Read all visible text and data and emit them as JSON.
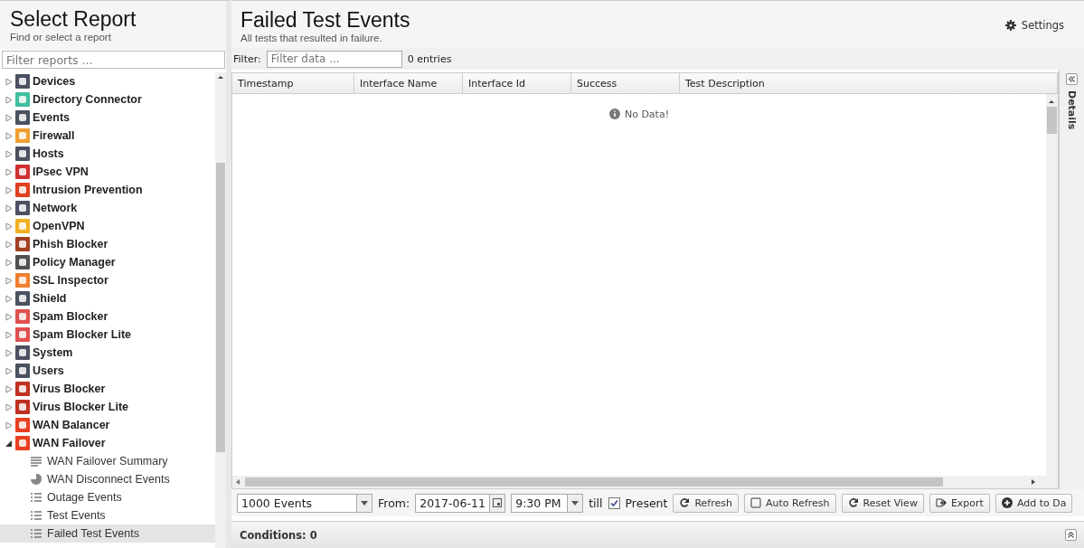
{
  "sidebar": {
    "title": "Select Report",
    "subtitle": "Find or select a report",
    "filter": {
      "placeholder": "Filter reports ..."
    },
    "items": [
      {
        "label": "Devices",
        "color": "#4a5160",
        "expanded": false
      },
      {
        "label": "Directory Connector",
        "color": "#3fbf9f",
        "expanded": false
      },
      {
        "label": "Events",
        "color": "#4a5160",
        "expanded": false
      },
      {
        "label": "Firewall",
        "color": "#f0a030",
        "expanded": false
      },
      {
        "label": "Hosts",
        "color": "#4a5160",
        "expanded": false
      },
      {
        "label": "IPsec VPN",
        "color": "#d03030",
        "expanded": false
      },
      {
        "label": "Intrusion Prevention",
        "color": "#e04020",
        "expanded": false
      },
      {
        "label": "Network",
        "color": "#4a5160",
        "expanded": false
      },
      {
        "label": "OpenVPN",
        "color": "#f0b020",
        "expanded": false
      },
      {
        "label": "Phish Blocker",
        "color": "#a04020",
        "expanded": false
      },
      {
        "label": "Policy Manager",
        "color": "#505050",
        "expanded": false
      },
      {
        "label": "SSL Inspector",
        "color": "#f08030",
        "expanded": false
      },
      {
        "label": "Shield",
        "color": "#4a5160",
        "expanded": false
      },
      {
        "label": "Spam Blocker",
        "color": "#e05050",
        "expanded": false
      },
      {
        "label": "Spam Blocker Lite",
        "color": "#e05050",
        "expanded": false
      },
      {
        "label": "System",
        "color": "#4a5160",
        "expanded": false
      },
      {
        "label": "Users",
        "color": "#4a5160",
        "expanded": false
      },
      {
        "label": "Virus Blocker",
        "color": "#c03020",
        "expanded": false
      },
      {
        "label": "Virus Blocker Lite",
        "color": "#c03020",
        "expanded": false
      },
      {
        "label": "WAN Balancer",
        "color": "#e84020",
        "expanded": false
      },
      {
        "label": "WAN Failover",
        "color": "#e84020",
        "expanded": true,
        "children": [
          {
            "label": "WAN Failover Summary",
            "kind": "summary",
            "selected": false
          },
          {
            "label": "WAN Disconnect Events",
            "kind": "pie",
            "selected": false
          },
          {
            "label": "Outage Events",
            "kind": "list",
            "selected": false
          },
          {
            "label": "Test Events",
            "kind": "list",
            "selected": false
          },
          {
            "label": "Failed Test Events",
            "kind": "list",
            "selected": true
          }
        ]
      }
    ]
  },
  "main": {
    "title": "Failed Test Events",
    "subtitle": "All tests that resulted in failure.",
    "settings": "Settings",
    "filter": {
      "label": "Filter:",
      "placeholder": "Filter data ...",
      "count": "0 entries"
    },
    "table": {
      "columns": [
        "Timestamp",
        "Interface Name",
        "Interface Id",
        "Success",
        "Test Description"
      ],
      "empty": "No Data!"
    },
    "toolbar": {
      "limit": "1000 Events",
      "from_label": "From:",
      "date": "2017-06-11",
      "time": "9:30 PM",
      "till": "till",
      "present": {
        "label": "Present",
        "checked": true
      },
      "buttons": [
        {
          "label": "Refresh",
          "kind": "refresh"
        },
        {
          "label": "Auto Refresh",
          "kind": "checkbox"
        },
        {
          "label": "Reset View",
          "kind": "refresh"
        },
        {
          "label": "Export",
          "kind": "export"
        },
        {
          "label": "Add to Da",
          "kind": "add"
        }
      ]
    },
    "conditions": "Conditions: 0",
    "details": "Details"
  }
}
